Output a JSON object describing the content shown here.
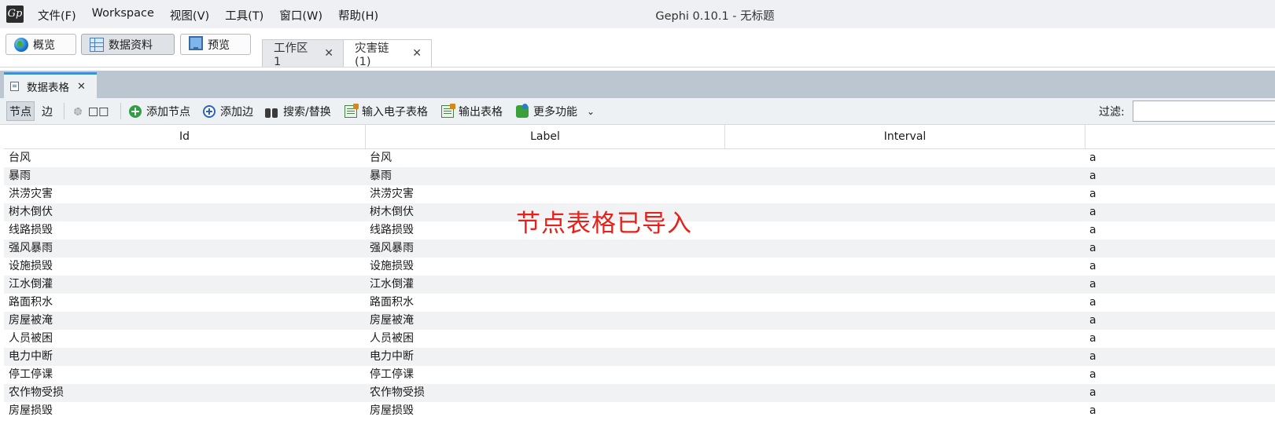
{
  "app": {
    "logo_text": "Gp",
    "window_title": "Gephi 0.10.1 - 无标题"
  },
  "menu": [
    "文件(F)",
    "Workspace",
    "视图(V)",
    "工具(T)",
    "窗口(W)",
    "帮助(H)"
  ],
  "modes": [
    {
      "label": "概览",
      "icon": "globe-icon",
      "active": false
    },
    {
      "label": "数据资料",
      "icon": "table-grid-icon",
      "active": true
    },
    {
      "label": "预览",
      "icon": "monitor-icon",
      "active": false
    }
  ],
  "workspace_tabs": [
    {
      "label": "工作区 1",
      "selected": false
    },
    {
      "label": "灾害链 (1)",
      "selected": true
    }
  ],
  "panel_tab": {
    "label": "数据表格"
  },
  "toolbar": {
    "nodes_label": "节点",
    "edges_label": "边",
    "config_label": "□□",
    "add_node": "添加节点",
    "add_edge": "添加边",
    "search_replace": "搜索/替换",
    "import_spreadsheet": "输入电子表格",
    "export_table": "输出表格",
    "more_actions": "更多功能",
    "filter_label": "过滤:",
    "filter_value": ""
  },
  "table": {
    "columns": [
      "Id",
      "Label",
      "Interval",
      ""
    ],
    "rows": [
      [
        "台风",
        "台风",
        "",
        "a"
      ],
      [
        "暴雨",
        "暴雨",
        "",
        "a"
      ],
      [
        "洪涝灾害",
        "洪涝灾害",
        "",
        "a"
      ],
      [
        "树木倒伏",
        "树木倒伏",
        "",
        "a"
      ],
      [
        "线路损毁",
        "线路损毁",
        "",
        "a"
      ],
      [
        "强风暴雨",
        "强风暴雨",
        "",
        "a"
      ],
      [
        "设施损毁",
        "设施损毁",
        "",
        "a"
      ],
      [
        "江水倒灌",
        "江水倒灌",
        "",
        "a"
      ],
      [
        "路面积水",
        "路面积水",
        "",
        "a"
      ],
      [
        "房屋被淹",
        "房屋被淹",
        "",
        "a"
      ],
      [
        "人员被困",
        "人员被困",
        "",
        "a"
      ],
      [
        "电力中断",
        "电力中断",
        "",
        "a"
      ],
      [
        "停工停课",
        "停工停课",
        "",
        "a"
      ],
      [
        "农作物受损",
        "农作物受损",
        "",
        "a"
      ],
      [
        "房屋损毁",
        "房屋损毁",
        "",
        "a"
      ]
    ]
  },
  "annotation": {
    "text": "节点表格已导入",
    "color": "#e8201a"
  }
}
